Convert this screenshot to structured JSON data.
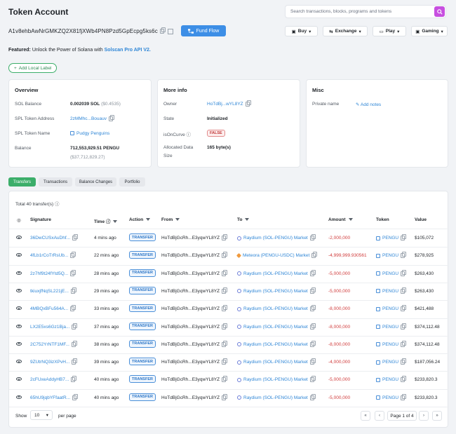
{
  "header": {
    "title": "Token Account",
    "search_placeholder": "Search transactions, blocks, programs and tokens",
    "address": "A1v8ehbAwNrGMKZQ2X81fjXWb4PN8Pzd5GpEcpg5ks6c",
    "fund_flow_label": "Fund Flow",
    "buttons": [
      {
        "label": "Buy"
      },
      {
        "label": "Exchange"
      },
      {
        "label": "Play"
      },
      {
        "label": "Gaming"
      }
    ],
    "featured_prefix": "Featured:",
    "featured_text": "Unlock the Power of Solana with",
    "featured_link": "Solscan Pro API V2.",
    "add_label": "Add Local Label"
  },
  "overview": {
    "title": "Overview",
    "sol_balance_label": "SOL Balance",
    "sol_balance_value": "0.002039 SOL",
    "sol_balance_usd": "($0.4535)",
    "spl_address_label": "SPL Token Address",
    "spl_address_value": "2zMMhc...Bouauv",
    "spl_name_label": "SPL Token Name",
    "spl_name_value": "Pudgy Penguins",
    "balance_label": "Balance",
    "balance_value": "712,553,929.51 PENGU",
    "balance_usd": "($37,712,829.27)"
  },
  "more_info": {
    "title": "More info",
    "owner_label": "Owner",
    "owner_value": "HoTdBj...wYL8YZ",
    "state_label": "State",
    "state_value": "Initialized",
    "curve_label": "isOnCurve",
    "curve_value": "FALSE",
    "alloc_label_1": "Allocated Data",
    "alloc_label_2": "Size",
    "alloc_value": "165 byte(s)"
  },
  "misc": {
    "title": "Misc",
    "private_label": "Private name",
    "add_notes": "Add notes"
  },
  "tabs": [
    {
      "label": "Transfers",
      "active": true
    },
    {
      "label": "Transactions",
      "active": false
    },
    {
      "label": "Balance Changes",
      "active": false
    },
    {
      "label": "Portfolio",
      "active": false
    }
  ],
  "table": {
    "total": "Total 40 transfer(s)",
    "headers": {
      "signature": "Signature",
      "time": "Time",
      "action": "Action",
      "from": "From",
      "to": "To",
      "amount": "Amount",
      "token": "Token",
      "value": "Value"
    },
    "rows": [
      {
        "sig": "36DwCUSxAuDhf...",
        "time": "4 mins ago",
        "action": "TRANSFER",
        "from": "HoTdBjGcRh...E3yqwYL8YZ",
        "to": "Raydium (SOL-PENGU) Market",
        "to_type": "ray",
        "amount": "-2,000,000",
        "token": "PENGU",
        "value": "$105,072"
      },
      {
        "sig": "4fLb1rCoTrRsUb...",
        "time": "22 mins ago",
        "action": "TRANSFER",
        "from": "HoTdBjGcRh...E3yqwYL8YZ",
        "to": "Meteora (PENGU-USDC) Market",
        "to_type": "met",
        "amount": "-4,999,999.930561",
        "token": "PENGU",
        "value": "$278,925"
      },
      {
        "sig": "2z7hf9t24fYtd5Q...",
        "time": "28 mins ago",
        "action": "TRANSFER",
        "from": "HoTdBjGcRh...E3yqwYL8YZ",
        "to": "Raydium (SOL-PENGU) Market",
        "to_type": "ray",
        "amount": "-5,000,000",
        "token": "PENGU",
        "value": "$263,430"
      },
      {
        "sig": "tkiuxjfNqSL221jE...",
        "time": "29 mins ago",
        "action": "TRANSFER",
        "from": "HoTdBjGcRh...E3yqwYL8YZ",
        "to": "Raydium (SOL-PENGU) Market",
        "to_type": "ray",
        "amount": "-5,000,000",
        "token": "PENGU",
        "value": "$263,430"
      },
      {
        "sig": "4MBQxBFu564A...",
        "time": "33 mins ago",
        "action": "TRANSFER",
        "from": "HoTdBjGcRh...E3yqwYL8YZ",
        "to": "Raydium (SOL-PENGU) Market",
        "to_type": "ray",
        "amount": "-8,000,000",
        "token": "PENGU",
        "value": "$421,488"
      },
      {
        "sig": "LX2E5xs6Gz1Bja...",
        "time": "37 mins ago",
        "action": "TRANSFER",
        "from": "HoTdBjGcRh...E3yqwYL8YZ",
        "to": "Raydium (SOL-PENGU) Market",
        "to_type": "ray",
        "amount": "-8,000,000",
        "token": "PENGU",
        "value": "$374,112.48"
      },
      {
        "sig": "2C752YrNTF1MF...",
        "time": "38 mins ago",
        "action": "TRANSFER",
        "from": "HoTdBjGcRh...E3yqwYL8YZ",
        "to": "Raydium (SOL-PENGU) Market",
        "to_type": "ray",
        "amount": "-8,000,000",
        "token": "PENGU",
        "value": "$374,112.48"
      },
      {
        "sig": "9ZUtrNQ3izXPvH...",
        "time": "39 mins ago",
        "action": "TRANSFER",
        "from": "HoTdBjGcRh...E3yqwYL8YZ",
        "to": "Raydium (SOL-PENGU) Market",
        "to_type": "ray",
        "amount": "-4,000,000",
        "token": "PENGU",
        "value": "$187,056.24"
      },
      {
        "sig": "2cFUxeAddyHB7...",
        "time": "40 mins ago",
        "action": "TRANSFER",
        "from": "HoTdBjGcRh...E3yqwYL8YZ",
        "to": "Raydium (SOL-PENGU) Market",
        "to_type": "ray",
        "amount": "-5,000,000",
        "token": "PENGU",
        "value": "$233,820.3"
      },
      {
        "sig": "65hU9jqbYFfaatR...",
        "time": "40 mins ago",
        "action": "TRANSFER",
        "from": "HoTdBjGcRh...E3yqwYL8YZ",
        "to": "Raydium (SOL-PENGU) Market",
        "to_type": "ray",
        "amount": "-5,000,000",
        "token": "PENGU",
        "value": "$233,820.3"
      }
    ],
    "footer": {
      "show_label": "Show",
      "page_size": "10",
      "per_page_label": "per page",
      "page_text": "Page 1 of 4"
    }
  },
  "colors": {
    "accent_green": "#3cae6a",
    "link_blue": "#2f86d6",
    "negative_red": "#d03b3b",
    "search_button": "#c74fe0"
  }
}
